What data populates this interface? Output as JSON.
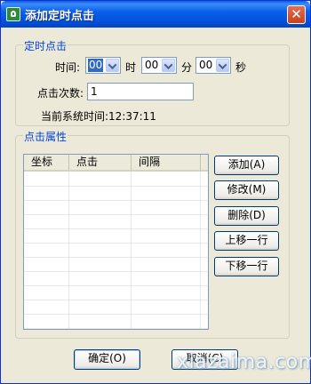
{
  "window": {
    "title": "添加定时点击"
  },
  "timer_group": {
    "label": "定时点击",
    "time_label": "时间:",
    "hour": "00",
    "hour_unit": "时",
    "minute": "00",
    "minute_unit": "分",
    "second": "00",
    "second_unit": "秒",
    "count_label": "点击次数:",
    "count_value": "1",
    "system_time": "当前系统时间:12:37:11"
  },
  "props_group": {
    "label": "点击属性",
    "columns": [
      "坐标",
      "点击",
      "间隔"
    ],
    "rows": []
  },
  "side_buttons": {
    "add": "添加(A)",
    "edit": "修改(M)",
    "delete": "删除(D)",
    "move_up": "上移一行",
    "move_down": "下移一行"
  },
  "footer": {
    "ok": "确定(O)",
    "cancel": "取消(C)"
  },
  "watermark": "xiazaima.com",
  "colors": {
    "titlebar": "#0a5fe0",
    "group_label": "#0046d5",
    "dialog_bg": "#ece9d8"
  }
}
